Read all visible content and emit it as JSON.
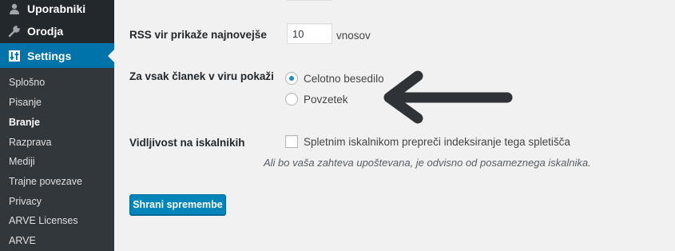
{
  "sidebar": {
    "menu": [
      {
        "label": "Uporabniki",
        "icon": "user-icon"
      },
      {
        "label": "Orodja",
        "icon": "wrench-icon"
      },
      {
        "label": "Settings",
        "icon": "settings-sliders-icon"
      }
    ],
    "submenu": [
      {
        "label": "Splošno"
      },
      {
        "label": "Pisanje"
      },
      {
        "label": "Branje",
        "active": true
      },
      {
        "label": "Razprava"
      },
      {
        "label": "Mediji"
      },
      {
        "label": "Trajne povezave"
      },
      {
        "label": "Privacy"
      },
      {
        "label": "ARVE Licenses"
      },
      {
        "label": "ARVE"
      }
    ]
  },
  "settings": {
    "rss": {
      "label": "RSS vir prikaže najnovejše",
      "value": "10",
      "suffix": "vnosov"
    },
    "feed_content": {
      "label": "Za vsak članek v viru pokaži",
      "options": [
        {
          "label": "Celotno besedilo",
          "checked": true
        },
        {
          "label": "Povzetek",
          "checked": false
        }
      ]
    },
    "visibility": {
      "label": "Vidljivost na iskalnikih",
      "checkbox_label": "Spletnim iskalnikom prepreči indeksiranje tega spletišča",
      "checked": false,
      "description": "Ali bo vaša zahteva upoštevana, je odvisno od posameznega iskalnika."
    },
    "save_label": "Shrani spremembe"
  },
  "colors": {
    "sidebar_bg": "#23282d",
    "submenu_bg": "#32373c",
    "accent": "#0073aa",
    "button": "#0085ba",
    "arrow": "#2f3237"
  }
}
